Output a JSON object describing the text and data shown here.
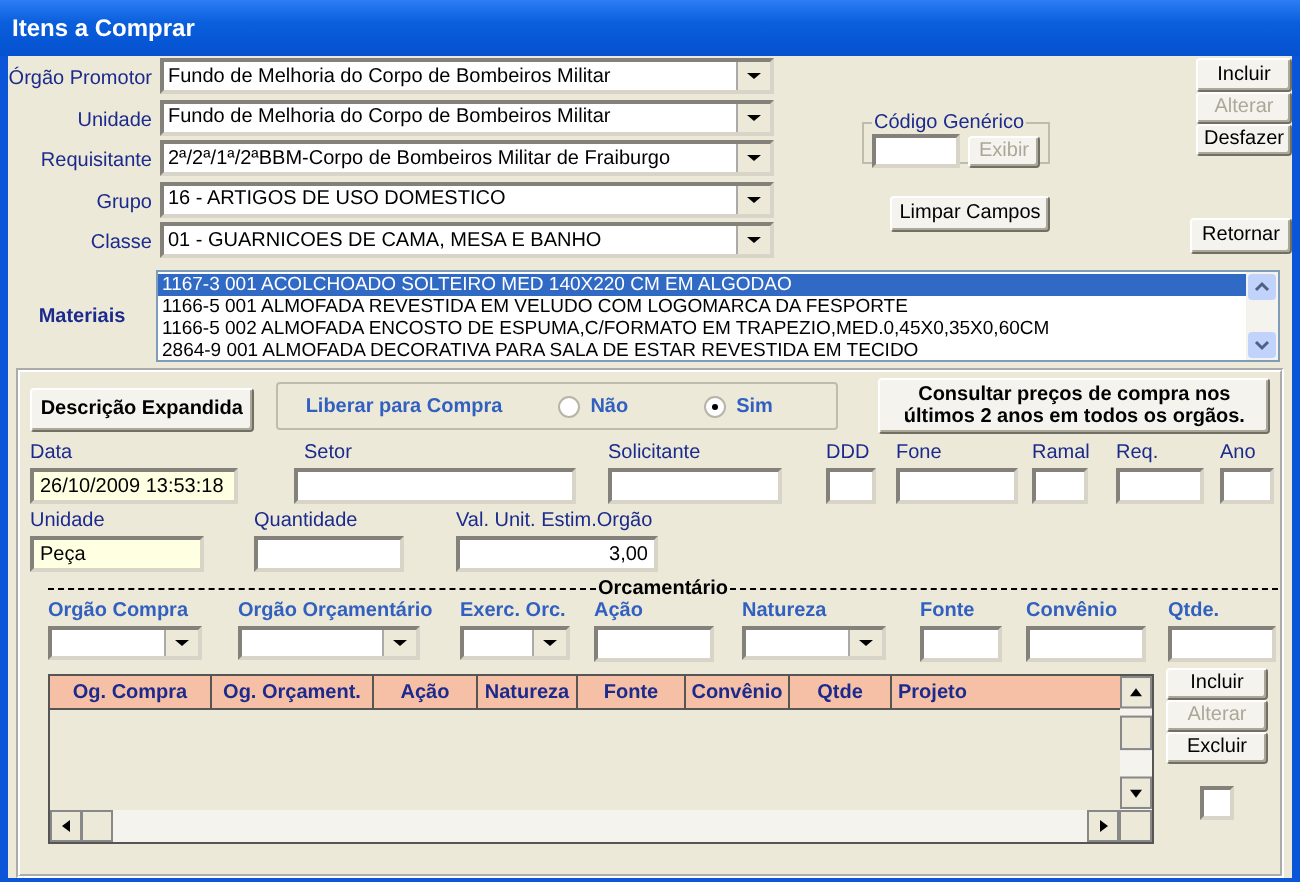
{
  "window": {
    "title": "Itens a Comprar"
  },
  "header_fields": [
    {
      "label": "Órgão Promotor",
      "value": "Fundo de Melhoria do Corpo de Bombeiros Militar"
    },
    {
      "label": "Unidade",
      "value": "Fundo de Melhoria do Corpo de Bombeiros Militar"
    },
    {
      "label": "Requisitante",
      "value": "2ª/2ª/1ª/2ªBBM-Corpo de Bombeiros Militar de Fraiburgo"
    },
    {
      "label": "Grupo",
      "value": "16 - ARTIGOS DE USO DOMESTICO"
    },
    {
      "label": "Classe",
      "value": "01 - GUARNICOES DE CAMA, MESA E BANHO"
    }
  ],
  "generic_code": {
    "legend": "Código Genérico",
    "button": {
      "label": "Exibir",
      "disabled": true
    }
  },
  "side_buttons": [
    {
      "label": "Incluir",
      "disabled": false
    },
    {
      "label": "Alterar",
      "disabled": true
    },
    {
      "label": "Desfazer",
      "disabled": false
    }
  ],
  "clear_button": {
    "label": "Limpar Campos"
  },
  "return_button": {
    "label": "Retornar"
  },
  "materials": {
    "label": "Materiais",
    "items": [
      {
        "text": "1167-3 001 ACOLCHOADO SOLTEIRO MED 140X220 CM EM ALGODAO",
        "selected": true
      },
      {
        "text": "1166-5 001 ALMOFADA REVESTIDA EM VELUDO COM LOGOMARCA DA FESPORTE",
        "selected": false
      },
      {
        "text": "1166-5 002 ALMOFADA ENCOSTO DE ESPUMA,C/FORMATO EM TRAPEZIO,MED.0,45X0,35X0,60CM",
        "selected": false
      },
      {
        "text": "2864-9 001 ALMOFADA DECORATIVA PARA SALA DE ESTAR REVESTIDA EM TECIDO",
        "selected": false
      }
    ]
  },
  "expanded_button": {
    "label": "Descrição Expandida"
  },
  "release": {
    "label": "Liberar para Compra",
    "options": [
      {
        "label": "Não",
        "selected": false
      },
      {
        "label": "Sim",
        "selected": true
      }
    ]
  },
  "consult_button": {
    "label": "Consultar preços de compra nos últimos 2 anos em todos os orgãos."
  },
  "fields_row_1": [
    {
      "label": "Data",
      "value": "26/10/2009 13:53:18",
      "kind": "readonly"
    },
    {
      "label": "Setor",
      "kind": "text"
    },
    {
      "label": "Solicitante",
      "kind": "text"
    },
    {
      "label": "DDD",
      "kind": "text"
    },
    {
      "label": "Fone",
      "kind": "text"
    },
    {
      "label": "Ramal",
      "kind": "text"
    },
    {
      "label": "Req.",
      "kind": "text"
    },
    {
      "label": "Ano",
      "kind": "text"
    }
  ],
  "fields_row_2": [
    {
      "label": "Unidade",
      "value": "Peça",
      "kind": "readonly"
    },
    {
      "label": "Quantidade",
      "kind": "text"
    },
    {
      "label": "Val. Unit. Estim.Orgão",
      "value": "3,00",
      "kind": "number"
    }
  ],
  "budget": {
    "legend": "Orcamentário",
    "fields": [
      {
        "label": "Orgão Compra",
        "kind": "combo"
      },
      {
        "label": "Orgão Orçamentário",
        "kind": "combo"
      },
      {
        "label": "Exerc. Orc.",
        "kind": "combo"
      },
      {
        "label": "Ação",
        "kind": "text"
      },
      {
        "label": "Natureza",
        "kind": "combo"
      },
      {
        "label": "Fonte",
        "kind": "text"
      },
      {
        "label": "Convênio",
        "kind": "text"
      },
      {
        "label": "Qtde.",
        "kind": "text"
      }
    ],
    "table": {
      "columns": [
        "Og. Compra",
        "Og. Orçament.",
        "Ação",
        "Natureza",
        "Fonte",
        "Convênio",
        "Qtde",
        "Projeto"
      ]
    },
    "buttons": [
      {
        "label": "Incluir",
        "disabled": false
      },
      {
        "label": "Alterar",
        "disabled": true
      },
      {
        "label": "Excluir",
        "disabled": false
      }
    ],
    "checkbox": {
      "checked": false
    }
  }
}
